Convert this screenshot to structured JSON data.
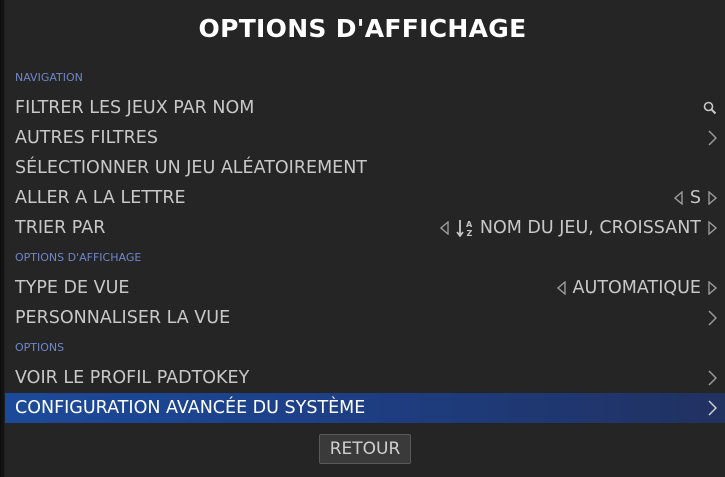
{
  "title": "OPTIONS D'AFFICHAGE",
  "sections": {
    "navigation": "NAVIGATION",
    "display": "OPTIONS D'AFFICHAGE",
    "options": "OPTIONS"
  },
  "rows": {
    "filter_by_name": {
      "label": "FILTRER LES JEUX PAR NOM",
      "icon": "search-icon"
    },
    "other_filters": {
      "label": "AUTRES FILTRES",
      "icon": "chevron-right-icon"
    },
    "random_game": {
      "label": "SÉLECTIONNER UN JEU ALÉATOIREMENT"
    },
    "jump_to_letter": {
      "label": "ALLER A LA LETTRE",
      "value": "S"
    },
    "sort_by": {
      "label": "TRIER PAR",
      "value": "NOM DU JEU, CROISSANT",
      "icon": "sort-alpha-icon"
    },
    "view_type": {
      "label": "TYPE DE VUE",
      "value": "AUTOMATIQUE"
    },
    "customize_view": {
      "label": "PERSONNALISER LA VUE"
    },
    "padtokey_profile": {
      "label": "VOIR LE PROFIL PADTOKEY"
    },
    "advanced_config": {
      "label": "CONFIGURATION AVANCÉE DU SYSTÈME",
      "selected": true
    }
  },
  "back_button": "RETOUR",
  "colors": {
    "background": "#252525",
    "section_header": "#6f86c9",
    "text": "#c8c8c8",
    "selected_row": "#1d3f86"
  }
}
